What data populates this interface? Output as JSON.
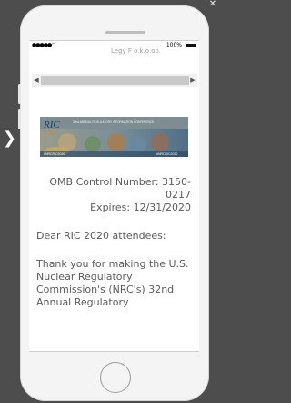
{
  "status_bar": {
    "signal_icon": "signal-dots-icon",
    "wifi_icon": "wifi-icon",
    "battery_percent": "100%",
    "battery_icon": "battery-icon"
  },
  "cutoff_text": "Legy F o.k.o.oo.",
  "scroll": {
    "left_icon": "arrow-left-icon",
    "right_icon": "arrow-right-icon"
  },
  "banner": {
    "logo": "RIC",
    "year": "2020",
    "headline": "32nd ANNUAL REGULATORY INFORMATION CONFERENCE",
    "left_tag": "#NRCRIC2020",
    "right_tag": "#NRCRIC2020"
  },
  "letter": {
    "omb": "OMB Control Number: 3150-0217",
    "expires": "Expires: 12/31/2020",
    "greeting": "Dear RIC 2020 attendees:",
    "body": "Thank you for making the U.S. Nuclear Regulatory Commission's (NRC's) 32nd Annual Regulatory"
  },
  "colors": {
    "background": "#4d4d4d",
    "phone_body": "#f4f4f4",
    "text": "#5b5b5b",
    "banner_dark": "#1f3f5c",
    "banner_accent": "#d9891e"
  }
}
